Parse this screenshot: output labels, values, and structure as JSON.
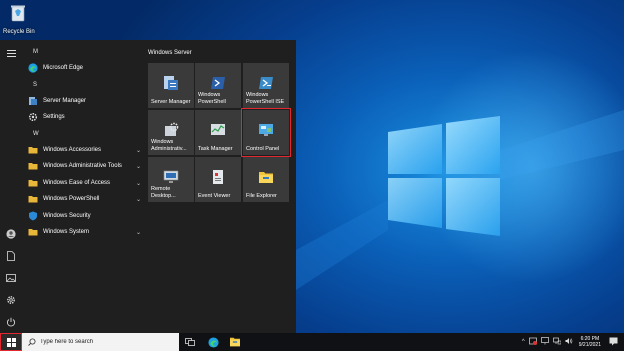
{
  "desktop": {
    "recycle_bin_label": "Recycle Bin"
  },
  "start_menu": {
    "letters": [
      "M",
      "S",
      "W"
    ],
    "apps": [
      {
        "label": "Microsoft Edge",
        "icon": "edge-icon",
        "expand": false
      },
      {
        "label": "Server Manager",
        "icon": "server-manager-icon",
        "expand": false
      },
      {
        "label": "Settings",
        "icon": "gear-icon",
        "expand": false
      },
      {
        "label": "Windows Accessories",
        "icon": "folder-icon",
        "expand": true
      },
      {
        "label": "Windows Administrative Tools",
        "icon": "folder-icon",
        "expand": true
      },
      {
        "label": "Windows Ease of Access",
        "icon": "folder-icon",
        "expand": true
      },
      {
        "label": "Windows PowerShell",
        "icon": "folder-icon",
        "expand": true
      },
      {
        "label": "Windows Security",
        "icon": "shield-icon",
        "expand": false
      },
      {
        "label": "Windows System",
        "icon": "folder-icon",
        "expand": true
      }
    ],
    "tiles_group": "Windows Server",
    "tiles": [
      {
        "label": "Server Manager",
        "icon": "server-manager-icon"
      },
      {
        "label": "Windows PowerShell",
        "icon": "powershell-icon"
      },
      {
        "label": "Windows PowerShell ISE",
        "icon": "powershell-ise-icon"
      },
      {
        "label": "Windows Administrativ...",
        "icon": "admin-tools-icon"
      },
      {
        "label": "Task Manager",
        "icon": "task-manager-icon"
      },
      {
        "label": "Control Panel",
        "icon": "control-panel-icon",
        "highlighted": true
      },
      {
        "label": "Remote Desktop...",
        "icon": "remote-desktop-icon"
      },
      {
        "label": "Event Viewer",
        "icon": "event-viewer-icon"
      },
      {
        "label": "File Explorer",
        "icon": "file-explorer-icon"
      }
    ]
  },
  "taskbar": {
    "search_placeholder": "Type here to search",
    "time": "6:20 PM",
    "date": "9/21/2021"
  },
  "colors": {
    "accent": "#0078d7",
    "highlight": "#e0282e",
    "tile_bg": "#3a3a3a",
    "menu_bg": "#1f1f1f"
  }
}
